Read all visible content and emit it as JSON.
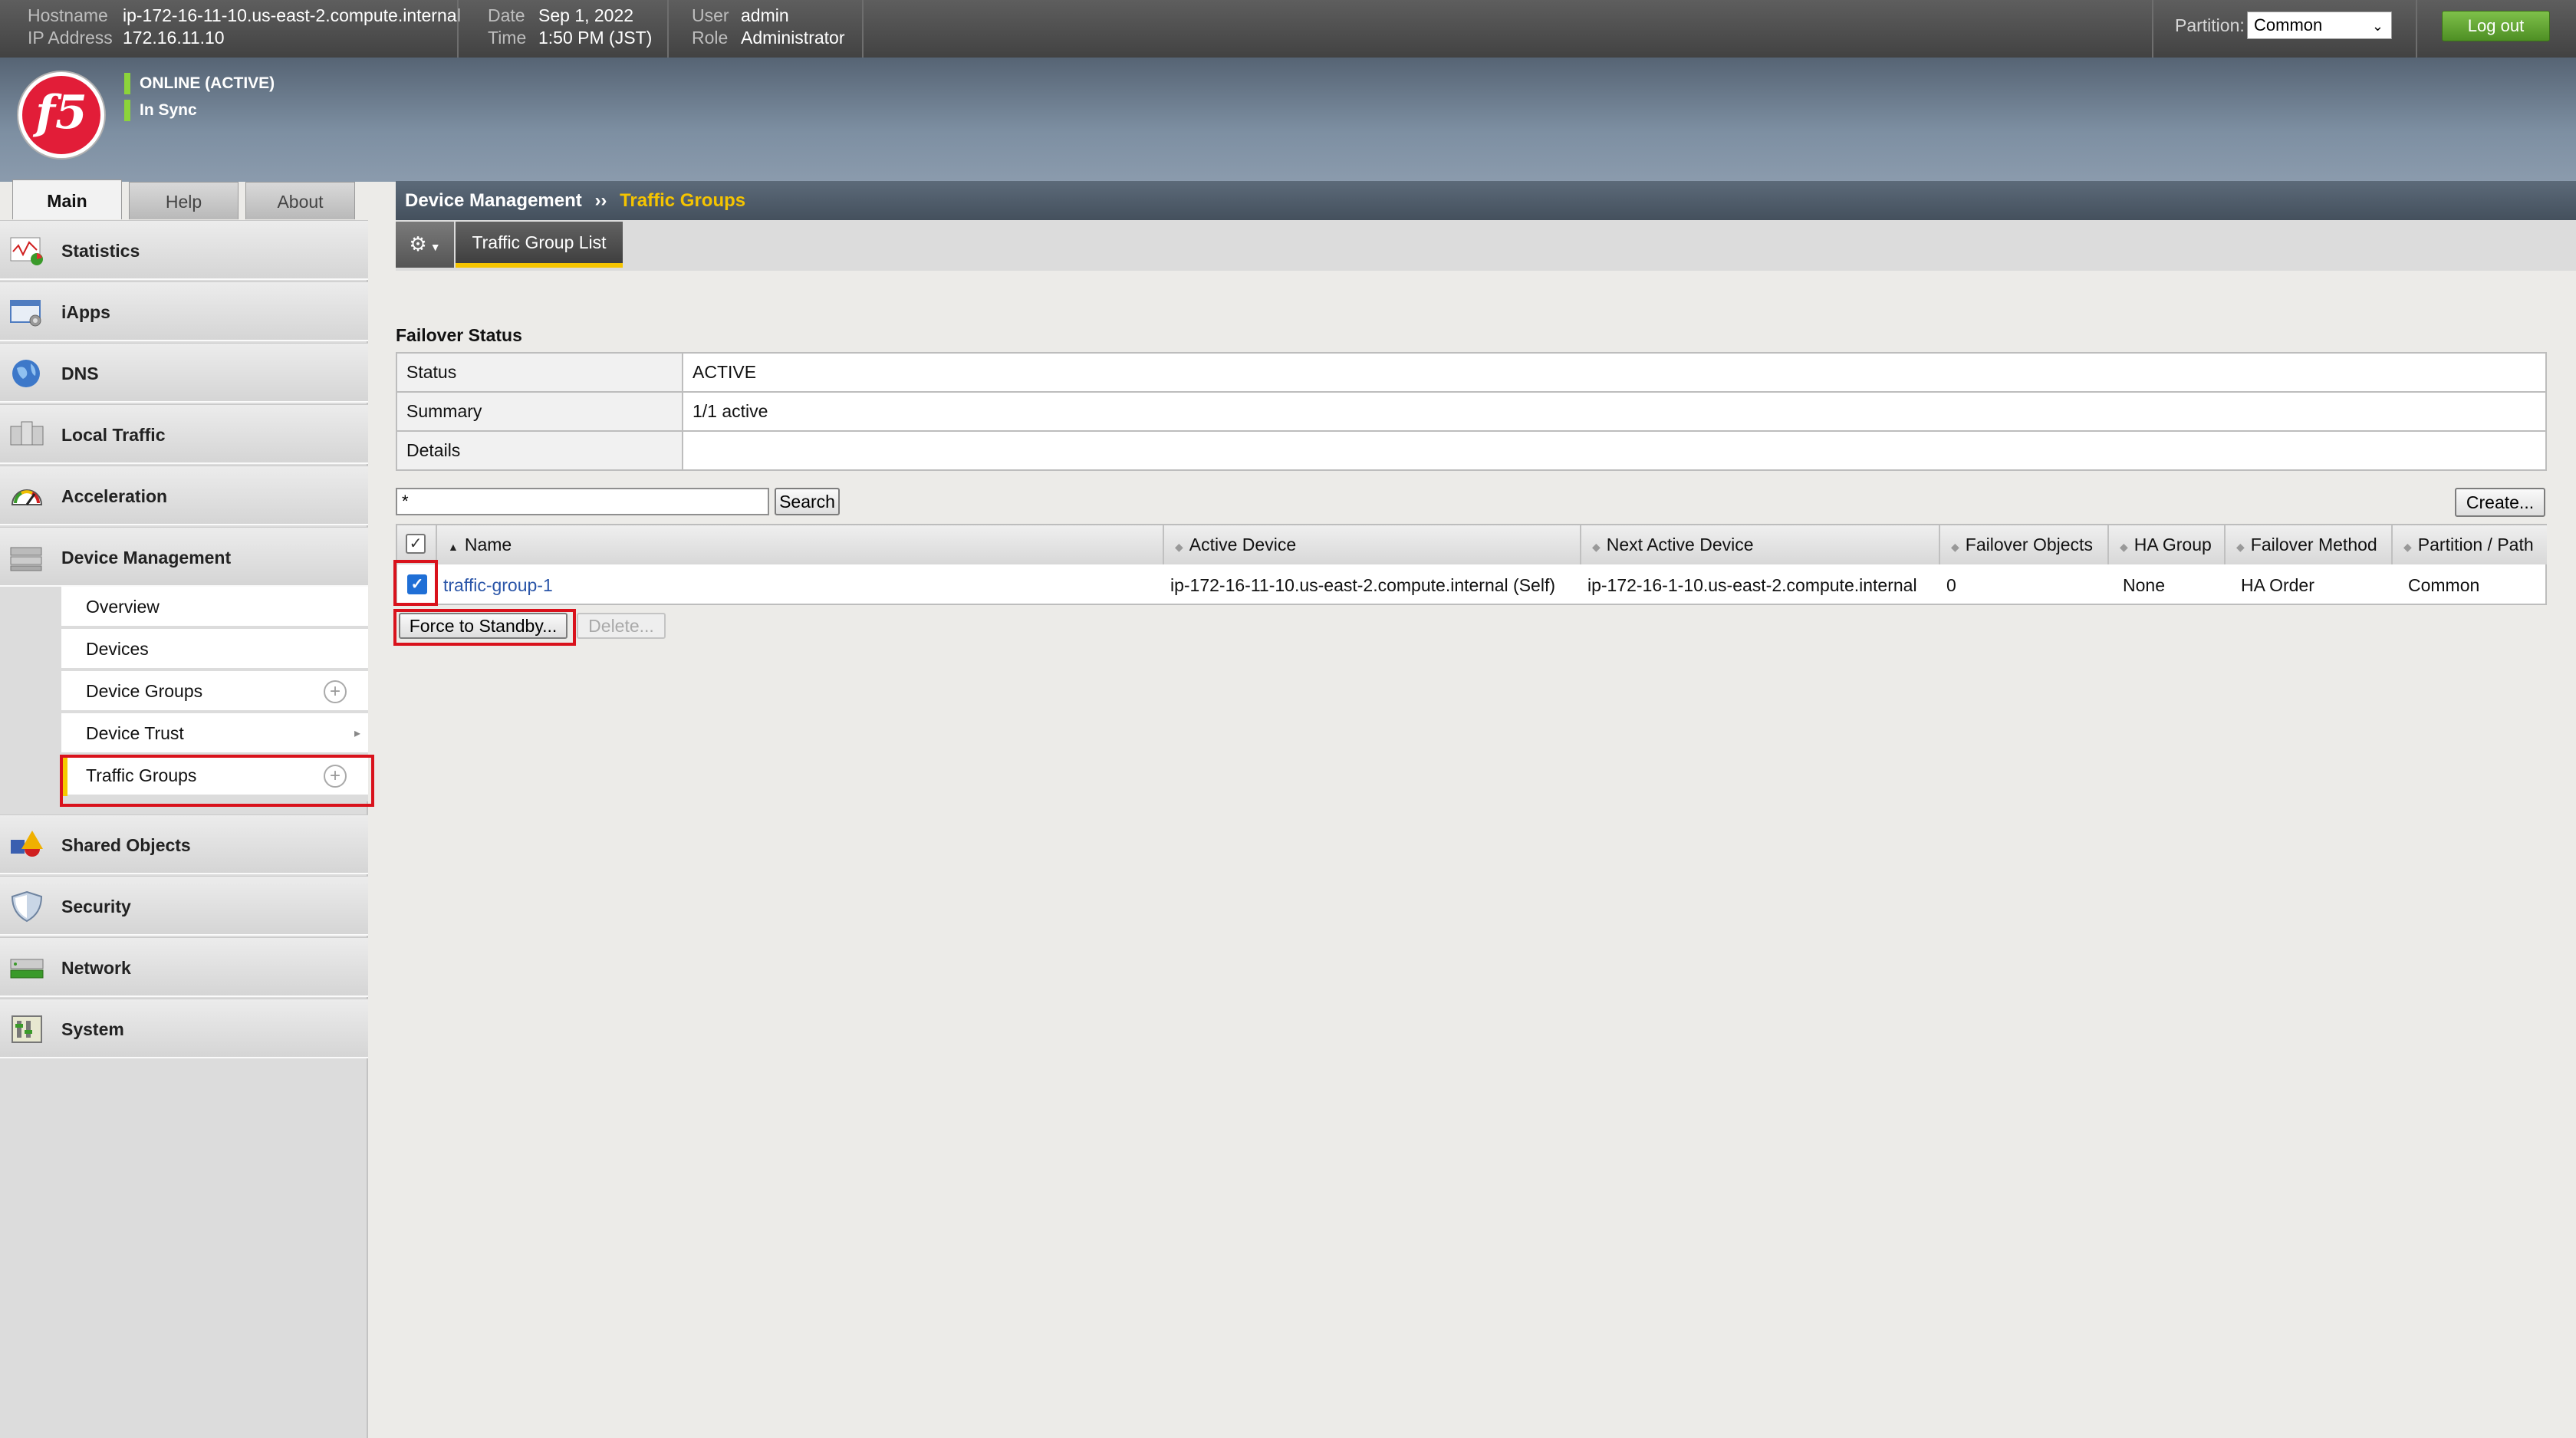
{
  "topbar": {
    "hostname_label": "Hostname",
    "hostname": "ip-172-16-11-10.us-east-2.compute.internal",
    "ip_label": "IP Address",
    "ip": "172.16.11.10",
    "date_label": "Date",
    "date": "Sep 1, 2022",
    "time_label": "Time",
    "time": "1:50 PM (JST)",
    "user_label": "User",
    "user": "admin",
    "role_label": "Role",
    "role": "Administrator",
    "partition_label": "Partition:",
    "partition_value": "Common",
    "logout_label": "Log out"
  },
  "header": {
    "status1": "ONLINE (ACTIVE)",
    "status2": "In Sync",
    "status_color": "#8cd43a"
  },
  "main_tabs": [
    "Main",
    "Help",
    "About"
  ],
  "nav": [
    "Statistics",
    "iApps",
    "DNS",
    "Local Traffic",
    "Acceleration",
    "Device Management",
    "Shared Objects",
    "Security",
    "Network",
    "System"
  ],
  "subnav": [
    "Overview",
    "Devices",
    "Device Groups",
    "Device Trust",
    "Traffic Groups"
  ],
  "breadcrumb": {
    "parent": "Device Management",
    "sep": "››",
    "current": "Traffic Groups"
  },
  "tabs": {
    "list": "Traffic Group List"
  },
  "failover": {
    "title": "Failover Status",
    "rows": [
      {
        "key": "Status",
        "value": "ACTIVE"
      },
      {
        "key": "Summary",
        "value": "1/1 active"
      },
      {
        "key": "Details",
        "value": ""
      }
    ]
  },
  "search": {
    "value": "*",
    "button": "Search"
  },
  "create_label": "Create...",
  "table": {
    "headers": [
      "Name",
      "Active Device",
      "Next Active Device",
      "Failover Objects",
      "HA Group",
      "Failover Method",
      "Partition / Path"
    ],
    "row": {
      "name": "traffic-group-1",
      "active": "ip-172-16-11-10.us-east-2.compute.internal (Self)",
      "next": "ip-172-16-1-10.us-east-2.compute.internal",
      "objects": "0",
      "ha": "None",
      "method": "HA Order",
      "partition": "Common"
    }
  },
  "actions": {
    "standby": "Force to Standby...",
    "delete": "Delete..."
  },
  "accent": "#f5c400",
  "highlight_color": "#d9121c"
}
